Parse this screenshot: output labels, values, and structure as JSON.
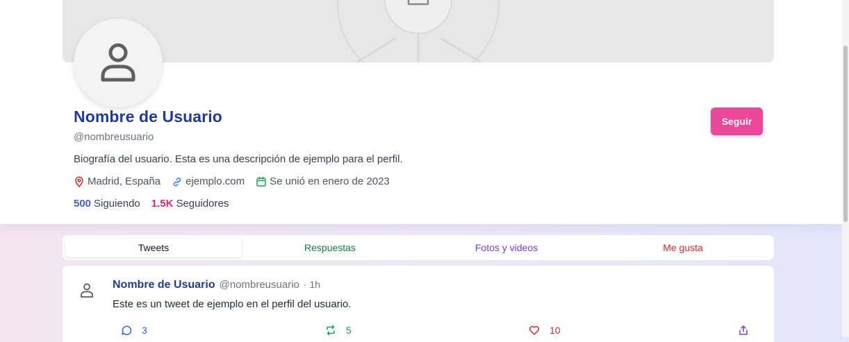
{
  "profile": {
    "display_name": "Nombre de Usuario",
    "handle": "@nombreusuario",
    "bio": "Biografía del usuario. Esta es una descripción de ejemplo para el perfil.",
    "location": "Madrid, España",
    "website": "ejemplo.com",
    "joined": "Se unió en enero de 2023",
    "following_count": "500",
    "following_label": "Siguiendo",
    "followers_count": "1.5K",
    "followers_label": "Seguidores",
    "follow_button_label": "Seguir"
  },
  "tabs": [
    {
      "label": "Tweets",
      "active": true
    },
    {
      "label": "Respuestas"
    },
    {
      "label": "Fotos y videos"
    },
    {
      "label": "Me gusta"
    }
  ],
  "tweet": {
    "author_name": "Nombre de Usuario",
    "author_handle": "@nombreusuario",
    "time": "· 1h",
    "text": "Este es un tweet de ejemplo en el perfil del usuario.",
    "replies": "3",
    "retweets": "5",
    "likes": "10"
  },
  "icons": {
    "avatar": "user-icon",
    "location": "map-pin-icon",
    "website": "link-icon",
    "joined": "calendar-icon",
    "reply": "message-circle-icon",
    "retweet": "repeat-icon",
    "like": "heart-icon",
    "share": "share-icon"
  },
  "colors": {
    "name": "#1e3a9f",
    "follow_button": "#ec4899",
    "following_count": "#3b5fd9",
    "followers_count": "#db2777",
    "replies_tab": "#15803d",
    "media_tab": "#7c3aed",
    "likes_tab": "#dc2626"
  }
}
